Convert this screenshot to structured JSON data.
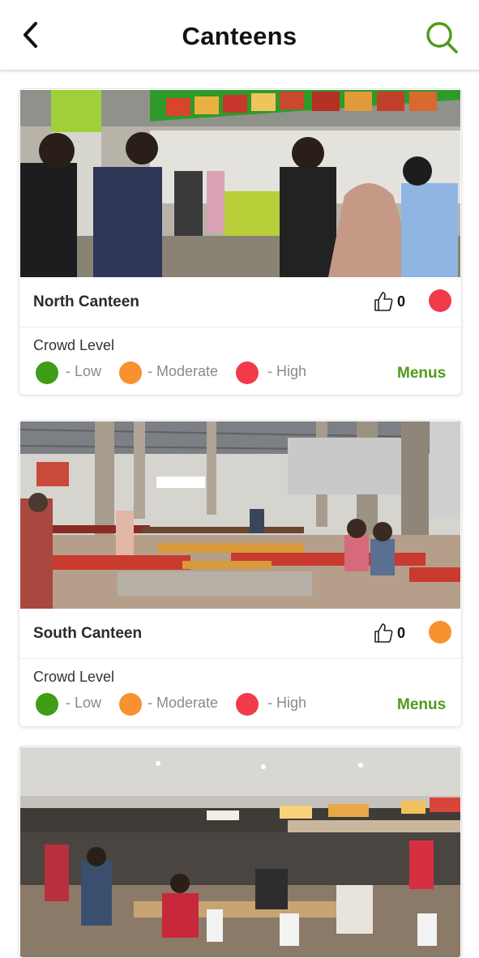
{
  "header": {
    "title": "Canteens",
    "back_icon": "chevron-left-icon",
    "search_icon": "search-icon"
  },
  "colors": {
    "accent": "#4f9a1b",
    "low": "#3f9d16",
    "moderate": "#f7922e",
    "high": "#f13b4a"
  },
  "canteens": [
    {
      "name": "North Canteen",
      "likes": "0",
      "crowd_status": "high",
      "crowd_label": "Crowd Level",
      "legend": [
        {
          "level": "low",
          "label": "- Low"
        },
        {
          "level": "moderate",
          "label": "- Moderate"
        },
        {
          "level": "high",
          "label": "- High"
        }
      ],
      "menus_label": "Menus"
    },
    {
      "name": "South Canteen",
      "likes": "0",
      "crowd_status": "moderate",
      "crowd_label": "Crowd Level",
      "legend": [
        {
          "level": "low",
          "label": "- Low"
        },
        {
          "level": "moderate",
          "label": "- Moderate"
        },
        {
          "level": "high",
          "label": "- High"
        }
      ],
      "menus_label": "Menus"
    },
    {
      "name": "",
      "likes": "",
      "crowd_status": "",
      "menus_label": ""
    }
  ]
}
